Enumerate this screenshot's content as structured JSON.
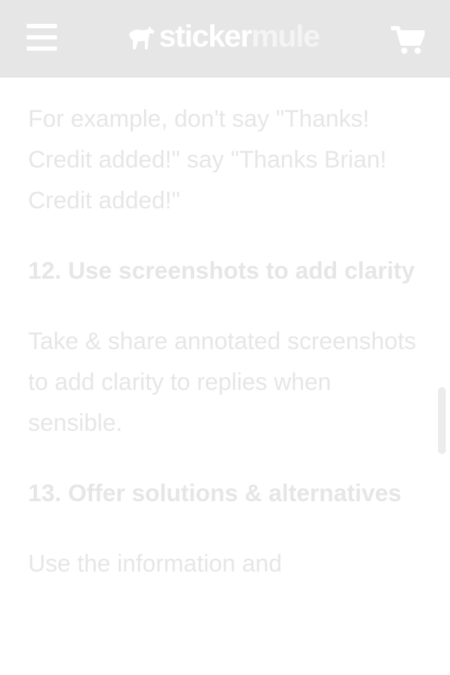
{
  "header": {
    "menu_icon": "hamburger-menu-icon",
    "logo_part1": "sticker",
    "logo_part2": "mule",
    "logo_icon": "mule-horse-icon",
    "cart_icon": "shopping-cart-icon"
  },
  "article": {
    "intro_paragraph": "For example, don't say \"Thanks! Credit added!\" say \"Thanks Brian! Credit added!\"",
    "sections": [
      {
        "heading": "12. Use screenshots to add clarity",
        "body": "Take & share annotated screenshots to add clarity to replies when sensible."
      },
      {
        "heading": "13. Offer solutions & alternatives",
        "body": "Use the information and"
      }
    ]
  },
  "colors": {
    "header_bg": "#e6e6e6",
    "text_faded": "#e6e6e6",
    "white": "#ffffff"
  }
}
